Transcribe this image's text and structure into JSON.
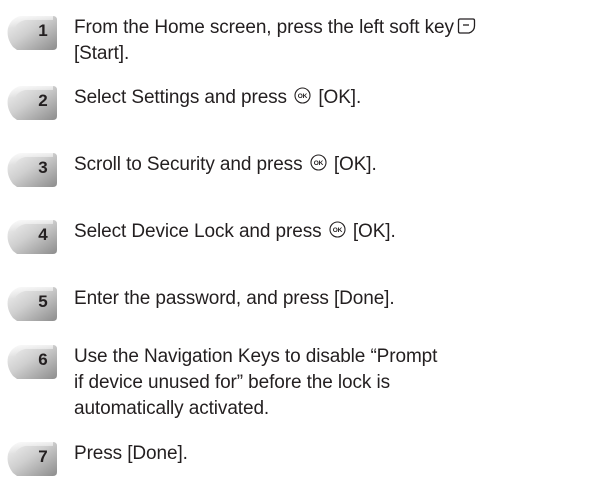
{
  "steps": [
    {
      "number": "1",
      "line1": "From the Home screen, press the left soft key",
      "line2": "[Start].",
      "icon": "left-softkey-icon"
    },
    {
      "number": "2",
      "before": "Select Settings and press",
      "after": "[OK].",
      "icon": "ok-key-icon"
    },
    {
      "number": "3",
      "before": "Scroll to Security and press",
      "after": "[OK].",
      "icon": "ok-key-icon"
    },
    {
      "number": "4",
      "before": "Select Device Lock and press",
      "after": "[OK].",
      "icon": "ok-key-icon"
    },
    {
      "number": "5",
      "text": "Enter the password, and press [Done]."
    },
    {
      "number": "6",
      "line1": "Use the Navigation Keys to disable “Prompt",
      "line2": "if device unused for” before the lock is",
      "line3": "automatically activated."
    },
    {
      "number": "7",
      "text": "Press [Done]."
    }
  ],
  "colors": {
    "text": "#231f20",
    "badge_light": "#d6d6d6",
    "badge_dark": "#8a8a8a"
  }
}
